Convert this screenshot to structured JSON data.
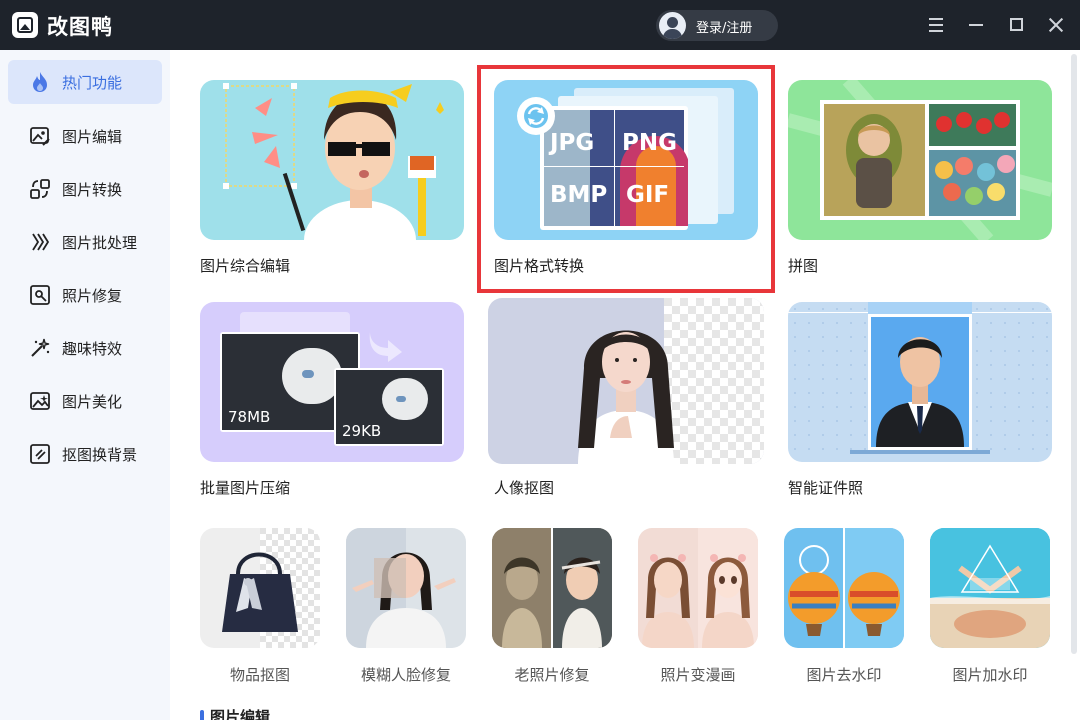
{
  "app": {
    "title": "改图鸭",
    "login_label": "登录/注册"
  },
  "sidebar": {
    "items": [
      {
        "label": "热门功能",
        "icon": "flame-icon",
        "active": true
      },
      {
        "label": "图片编辑",
        "icon": "image-edit-icon"
      },
      {
        "label": "图片转换",
        "icon": "convert-icon"
      },
      {
        "label": "图片批处理",
        "icon": "batch-icon"
      },
      {
        "label": "照片修复",
        "icon": "photo-repair-icon"
      },
      {
        "label": "趣味特效",
        "icon": "magic-wand-icon"
      },
      {
        "label": "图片美化",
        "icon": "image-beautify-icon"
      },
      {
        "label": "抠图换背景",
        "icon": "cutout-icon"
      }
    ]
  },
  "cards": [
    {
      "label": "图片综合编辑"
    },
    {
      "label": "图片格式转换",
      "formats": [
        "JPG",
        "PNG",
        "BMP",
        "GIF"
      ]
    },
    {
      "label": "拼图"
    },
    {
      "label": "批量图片压缩",
      "size_before": "78MB",
      "size_after": "29KB"
    },
    {
      "label": "人像抠图"
    },
    {
      "label": "智能证件照"
    }
  ],
  "small_cards": [
    {
      "label": "物品抠图"
    },
    {
      "label": "模糊人脸修复"
    },
    {
      "label": "老照片修复"
    },
    {
      "label": "照片变漫画"
    },
    {
      "label": "图片去水印"
    },
    {
      "label": "图片加水印"
    }
  ],
  "section": {
    "title": "图片编辑"
  },
  "colors": {
    "accent": "#3b6fe0",
    "highlight": "#e8363a",
    "titlebar": "#1e232b"
  }
}
